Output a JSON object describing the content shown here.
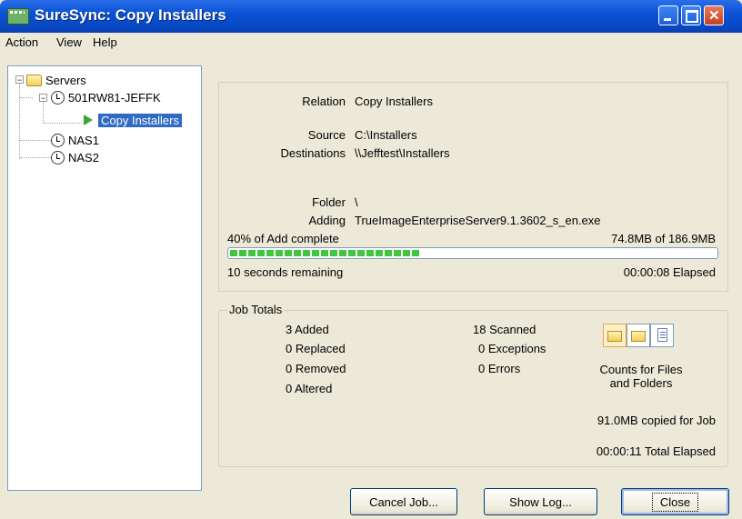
{
  "window": {
    "title": "SureSync: Copy Installers"
  },
  "menu": [
    "Action",
    "View",
    "Help"
  ],
  "tree": {
    "root": "Servers",
    "server1": "501RW81-JEFFK",
    "job": "Copy Installers",
    "server2": "NAS1",
    "server3": "NAS2"
  },
  "details": {
    "relation_label": "Relation",
    "relation_value": "Copy Installers",
    "source_label": "Source",
    "source_value": "C:\\Installers",
    "destinations_label": "Destinations",
    "destinations_value": "\\\\Jefftest\\Installers",
    "folder_label": "Folder",
    "folder_value": "\\",
    "adding_label": "Adding",
    "adding_value": "TrueImageEnterpriseServer9.1.3602_s_en.exe"
  },
  "progress": {
    "status": "40% of Add complete",
    "size": "74.8MB of 186.9MB",
    "percent": 40,
    "remaining": "10 seconds remaining",
    "elapsed": "00:00:08 Elapsed"
  },
  "totals": {
    "title": "Job Totals",
    "added": "3 Added",
    "replaced": "0 Replaced",
    "removed": "0 Removed",
    "altered": "0 Altered",
    "scanned": "18 Scanned",
    "exceptions": "0 Exceptions",
    "errors": "0 Errors",
    "counts_line1": "Counts for Files",
    "counts_line2": "and Folders",
    "copied": "91.0MB copied for Job",
    "total_elapsed": "00:00:11 Total Elapsed"
  },
  "buttons": {
    "cancel": "Cancel Job...",
    "show_log": "Show Log...",
    "close": "Close"
  },
  "colors": {
    "titlebar": "#0a52d6",
    "selection": "#316ac5",
    "progress": "#3ec63e"
  }
}
